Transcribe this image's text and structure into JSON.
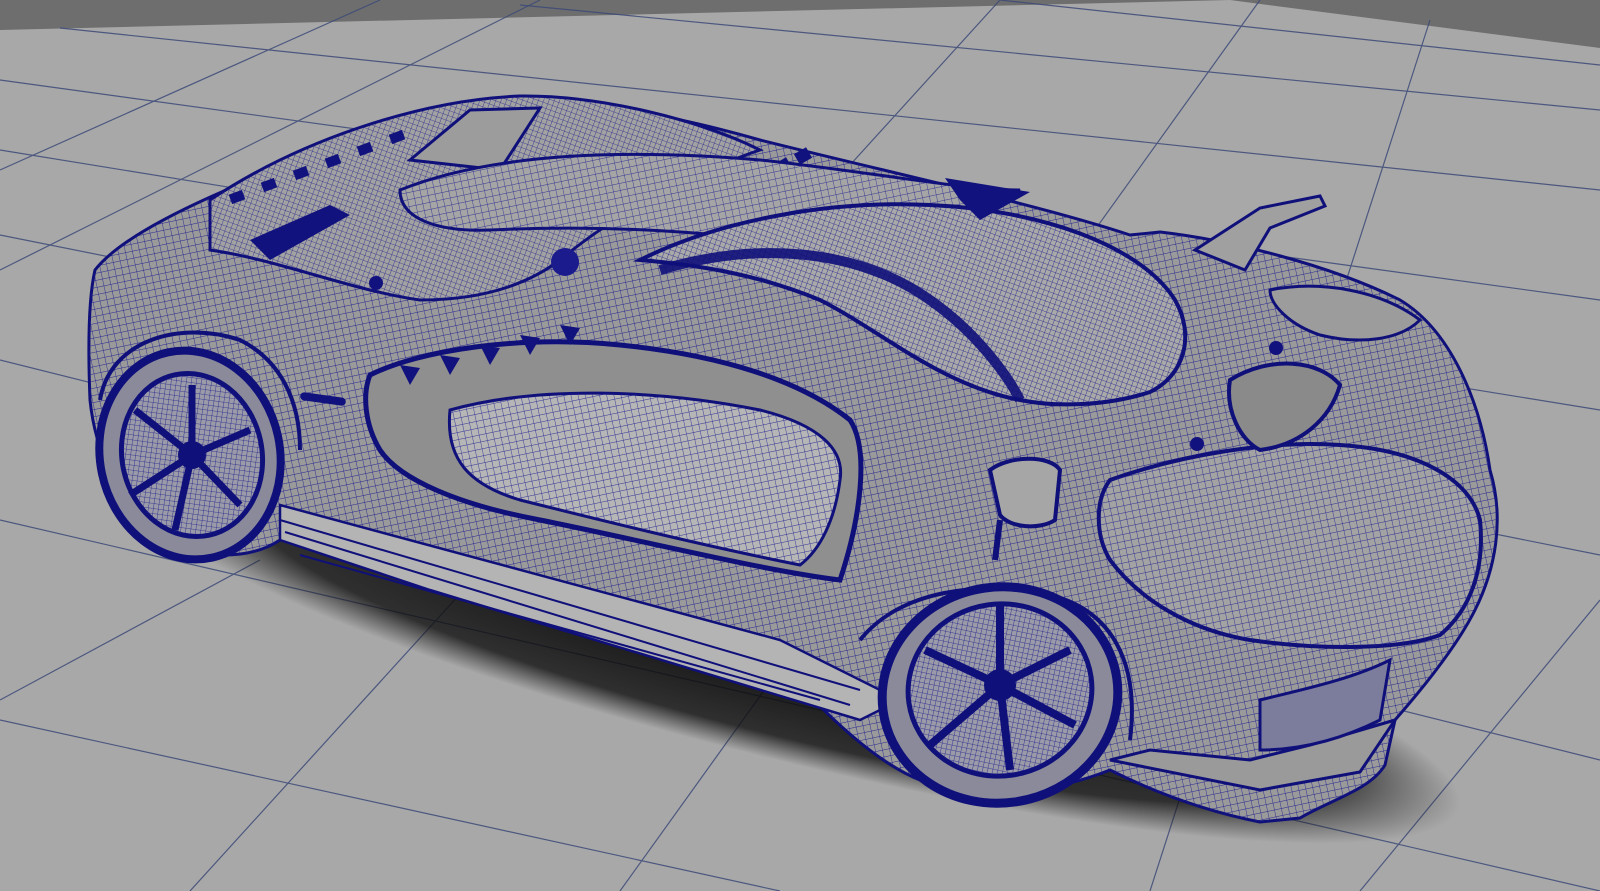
{
  "viewport": {
    "panel": "perspective-view",
    "display_mode": "wireframe-on-shaded",
    "wireframe_color": "#11118a",
    "background_color": "#6e6e6e",
    "ground_color": "#a8a8a8",
    "grid_color": "#3c4a78",
    "shadow_color": "#0a0a0a"
  },
  "model": {
    "subject": "sports-car",
    "body_color": "#9a9a9a"
  }
}
